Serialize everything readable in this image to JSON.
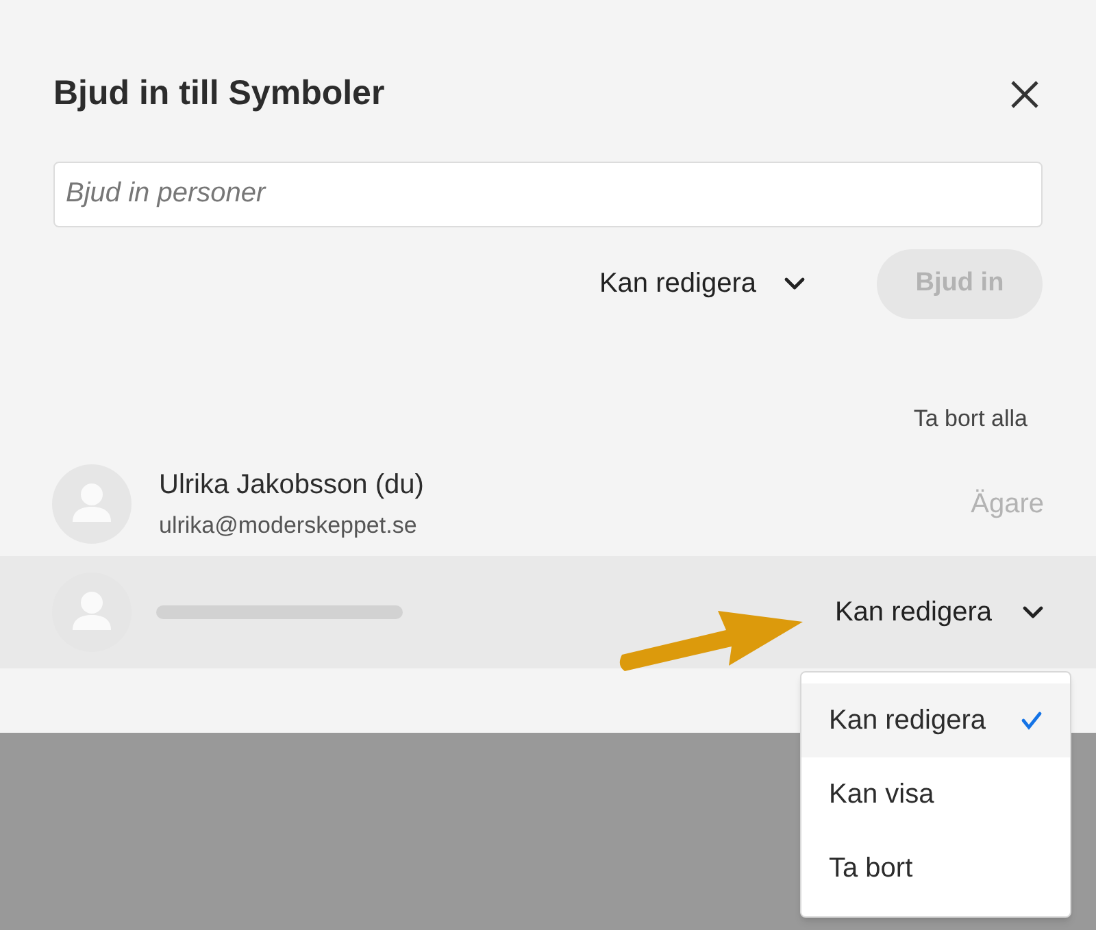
{
  "dialog": {
    "title": "Bjud in till Symboler",
    "invite_field": {
      "placeholder": "Bjud in personer"
    },
    "permission": "Kan redigera",
    "invite_button": {
      "label": "Bjud in",
      "disabled": true
    },
    "remove_all": "Ta bort alla"
  },
  "people": [
    {
      "kind": "owner",
      "name": "Ulrika Jakobsson (du)",
      "email": "ulrika@moderskeppet.se",
      "role": "Ägare"
    },
    {
      "kind": "editable",
      "role": "Kan redigera"
    }
  ],
  "menu": [
    {
      "label": "Kan redigera",
      "selected": true
    },
    {
      "label": "Kan visa",
      "selected": false
    },
    {
      "label": "Ta bort",
      "selected": false
    }
  ]
}
